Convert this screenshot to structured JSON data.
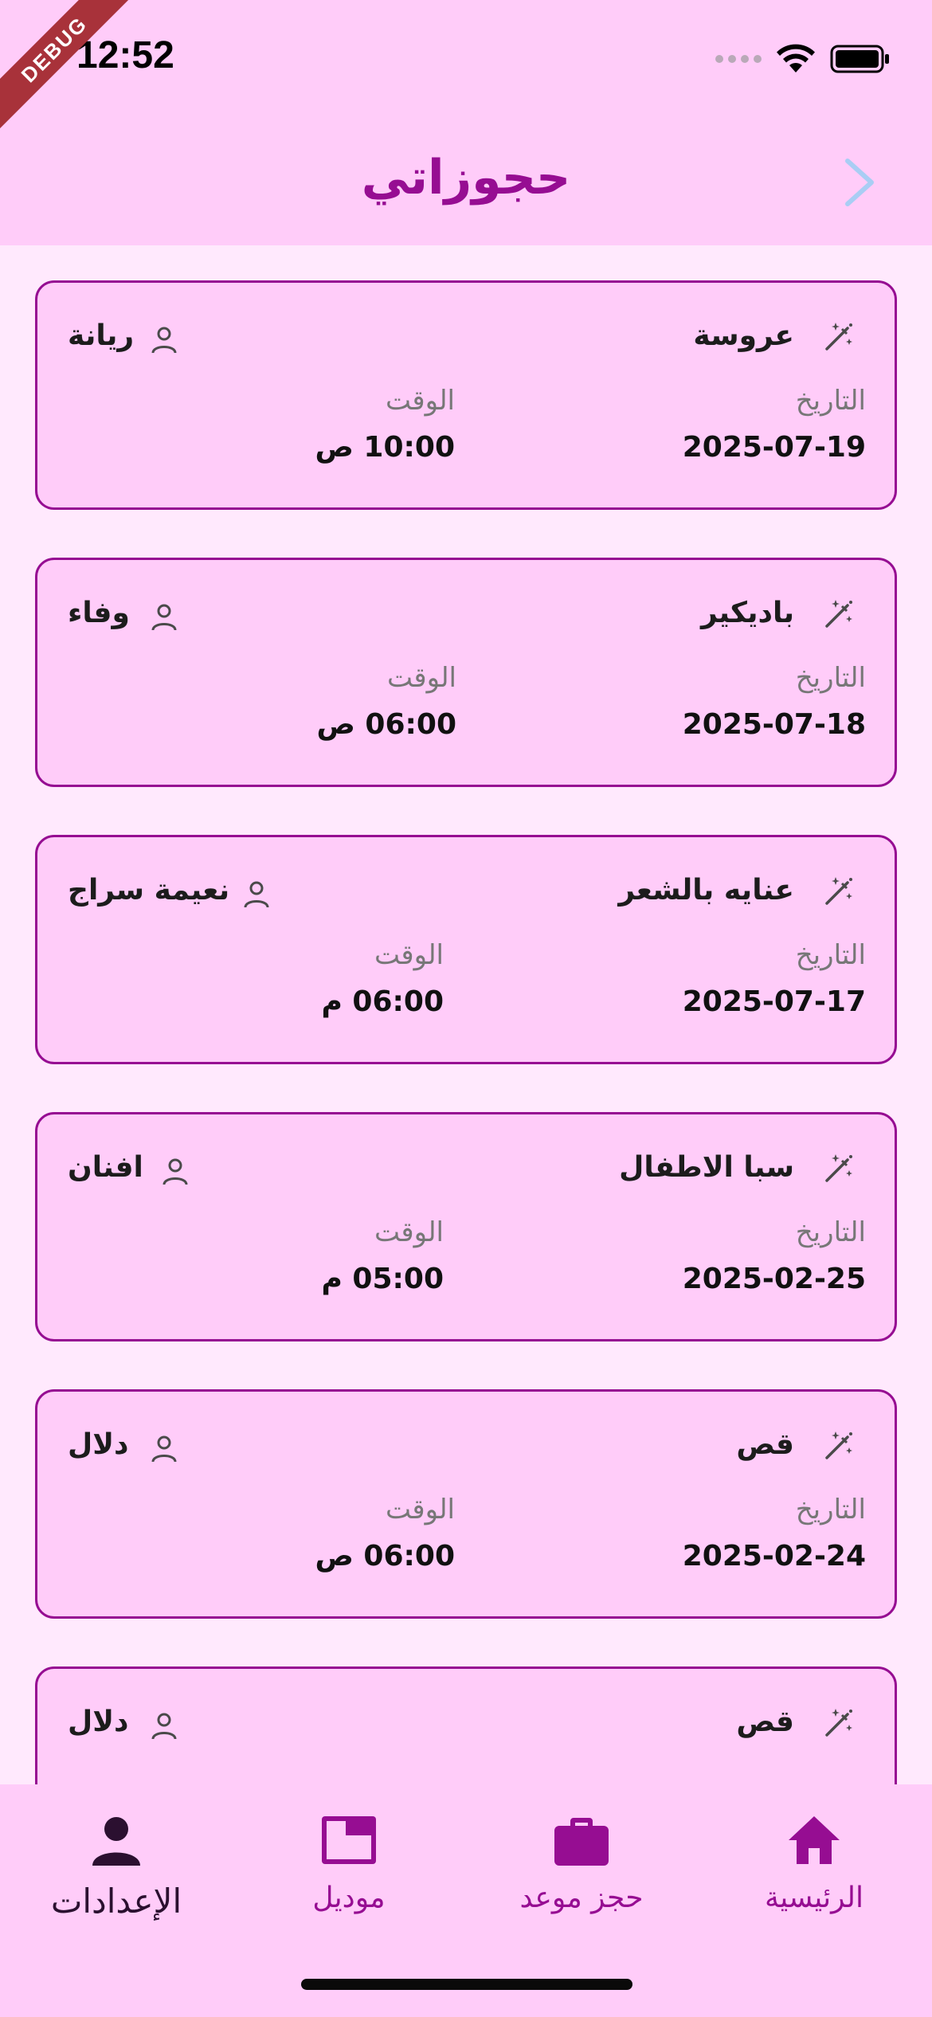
{
  "status_bar": {
    "time": "12:52",
    "debug_label": "DEBUG"
  },
  "header": {
    "title": "حجوزاتي",
    "back_icon": "chevron-right-icon"
  },
  "labels": {
    "date": "التاريخ",
    "time": "الوقت"
  },
  "bookings": [
    {
      "service": "عروسة",
      "client": "ريانة",
      "date": "2025-07-19",
      "time": "10:00 ص"
    },
    {
      "service": "باديكير",
      "client": "وفاء",
      "date": "2025-07-18",
      "time": "06:00 ص"
    },
    {
      "service": "عنايه بالشعر",
      "client": "نعيمة سراج",
      "date": "2025-07-17",
      "time": "06:00 م"
    },
    {
      "service": "سبا الاطفال",
      "client": "افنان",
      "date": "2025-02-25",
      "time": "05:00 م"
    },
    {
      "service": "قص",
      "client": "دلال",
      "date": "2025-02-24",
      "time": "06:00 ص"
    },
    {
      "service": "قص",
      "client": "دلال",
      "date": "",
      "time": ""
    }
  ],
  "bottom_nav": [
    {
      "label": "الرئيسية",
      "icon": "home-icon",
      "active": false
    },
    {
      "label": "حجز موعد",
      "icon": "briefcase-icon",
      "active": false
    },
    {
      "label": "موديل",
      "icon": "window-icon",
      "active": false
    },
    {
      "label": "الإعدادات",
      "icon": "person-icon",
      "active": true
    }
  ],
  "colors": {
    "primary": "#960d92",
    "app_bar_bg": "#ffccf9",
    "page_bg": "#ffe9fd",
    "card_bg": "#ffccf9",
    "back_arrow": "#a9cdf4"
  }
}
